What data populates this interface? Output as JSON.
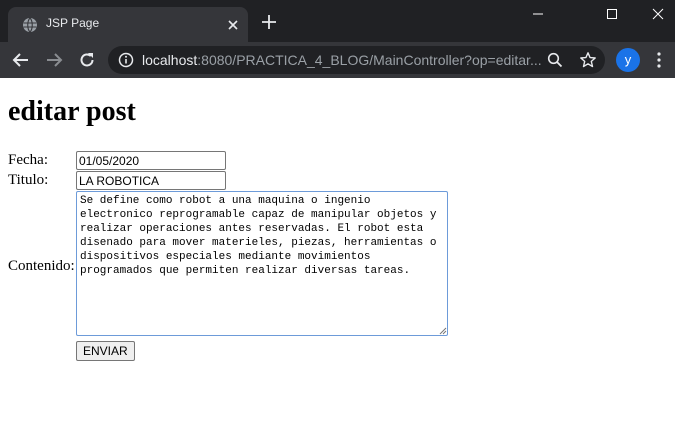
{
  "browser": {
    "tab_title": "JSP Page",
    "url_host": "localhost",
    "url_rest": ":8080/PRACTICA_4_BLOG/MainController?op=editar...",
    "profile_initial": "y",
    "colors": {
      "frame": "#202124",
      "toolbar": "#35363a",
      "avatar": "#1a73e8"
    }
  },
  "page": {
    "title": "editar post",
    "form": {
      "fecha_label": "Fecha:",
      "fecha_value": "01/05/2020",
      "titulo_label": "Titulo:",
      "titulo_value": "LA ROBOTICA",
      "contenido_label": "Contenido:",
      "contenido_value": "Se define como robot a una maquina o ingenio electronico reprogramable capaz de manipular objetos y realizar operaciones antes reservadas. El robot esta disenado para mover materieles, piezas, herramientas o dispositivos especiales mediante movimientos programados que permiten realizar diversas tareas.",
      "submit_label": "ENVIAR"
    }
  }
}
